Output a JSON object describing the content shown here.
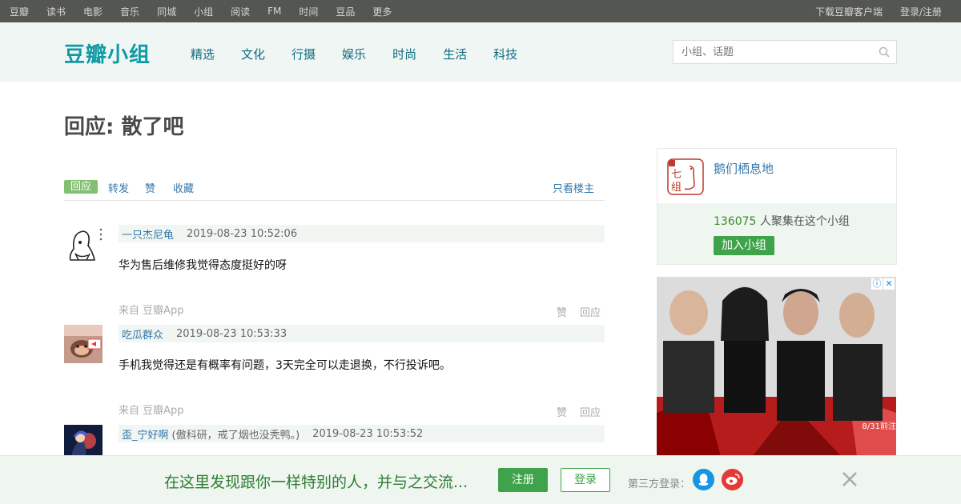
{
  "topnav": {
    "left": [
      "豆瓣",
      "读书",
      "电影",
      "音乐",
      "同城",
      "小组",
      "阅读",
      "FM",
      "时间",
      "豆品",
      "更多"
    ],
    "right": [
      "下载豆瓣客户端",
      "登录/注册"
    ]
  },
  "header": {
    "logo": "豆瓣小组",
    "nav": [
      "精选",
      "文化",
      "行摄",
      "娱乐",
      "时尚",
      "生活",
      "科技"
    ],
    "search_placeholder": "小组、话题"
  },
  "topic": {
    "title": "回应: 散了吧"
  },
  "actions": {
    "reply": "回应",
    "forward": "转发",
    "like": "赞",
    "collect": "收藏",
    "only_op": "只看楼主"
  },
  "comments": [
    {
      "user": "一只杰尼龟",
      "signature": "",
      "time": "2019-08-23 10:52:06",
      "text": "华为售后维修我觉得态度挺好的呀",
      "from": "来自 豆瓣App",
      "like": "赞",
      "reply": "回应"
    },
    {
      "user": "吃瓜群众",
      "signature": "",
      "time": "2019-08-23 10:53:33",
      "text": "手机我觉得还是有概率有问题，3天完全可以走退换，不行投诉吧。",
      "from": "来自 豆瓣App",
      "like": "赞",
      "reply": "回应"
    },
    {
      "user": "歪_宁好啊",
      "signature": "(傲科研，戒了烟也没秃鸭。)",
      "time": "2019-08-23 10:53:52",
      "text": "",
      "from": "",
      "like": "",
      "reply": ""
    }
  ],
  "group": {
    "name": "鹅们栖息地",
    "member_count": "136075",
    "member_suffix": " 人聚集在这个小组",
    "join": "加入小组"
  },
  "ad": {
    "date_text": "8/31前注"
  },
  "banner": {
    "message": "在这里发现跟你一样特别的人，并与之交流...",
    "register": "注册",
    "login": "登录",
    "third_party": "第三方登录："
  },
  "colors": {
    "topnav_bg": "#545652",
    "logo": "#0e9ba4",
    "link": "#3377aa",
    "green_button": "#3ea34a"
  }
}
